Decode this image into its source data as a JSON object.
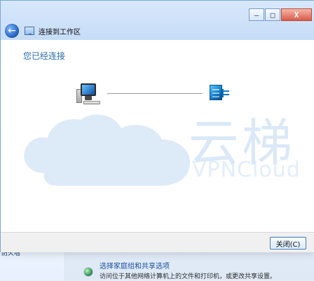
{
  "window": {
    "caption_buttons": {
      "minimize": "—",
      "maximize": "□",
      "close": "X"
    },
    "nav_title": "连接到工作区"
  },
  "dialog": {
    "headline": "您已经连接",
    "close_button": "关闭(C)"
  },
  "watermark": {
    "cn": "云梯",
    "en": "VPNCloud"
  },
  "background_window": {
    "left_text": "防火墙",
    "link_title": "选择家庭组和共享选项",
    "link_desc": "访问位于其他网络计算机上的文件和打印机，或更改共享设置。"
  }
}
